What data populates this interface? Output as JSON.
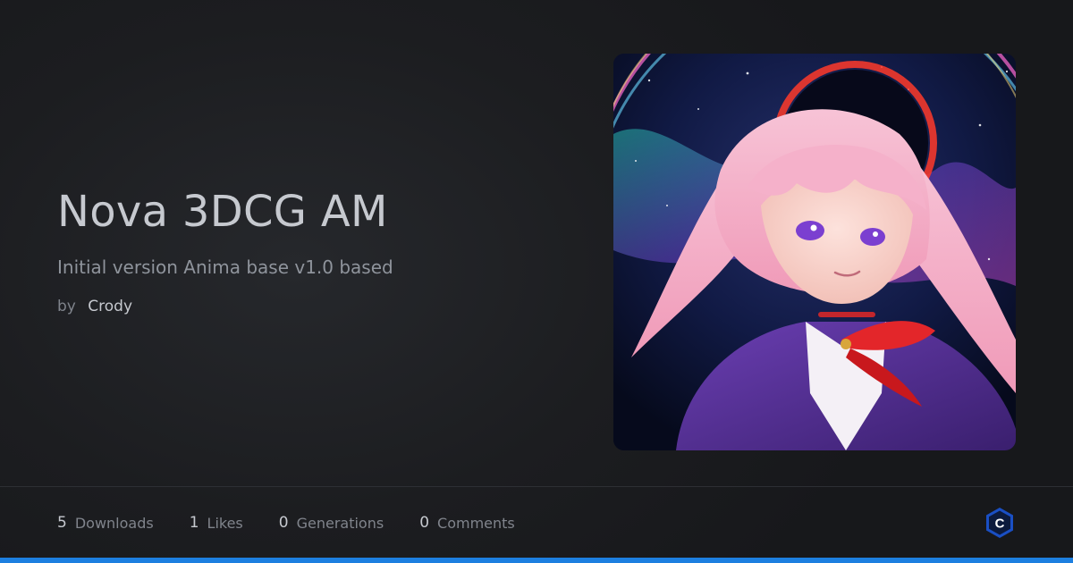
{
  "model": {
    "title": "Nova 3DCG AM",
    "subtitle": "Initial version Anima base v1.0 based",
    "author_prefix": "by",
    "author_name": "Crody"
  },
  "stats": [
    {
      "value": "5",
      "label": "Downloads"
    },
    {
      "value": "1",
      "label": "Likes"
    },
    {
      "value": "0",
      "label": "Generations"
    },
    {
      "value": "0",
      "label": "Comments"
    }
  ],
  "brand": {
    "logo_icon": "civitai-logo-icon",
    "logo_letter": "C",
    "accent_color": "#1d7fe0"
  },
  "preview_image": {
    "icon": "anime-girl-illustration"
  }
}
